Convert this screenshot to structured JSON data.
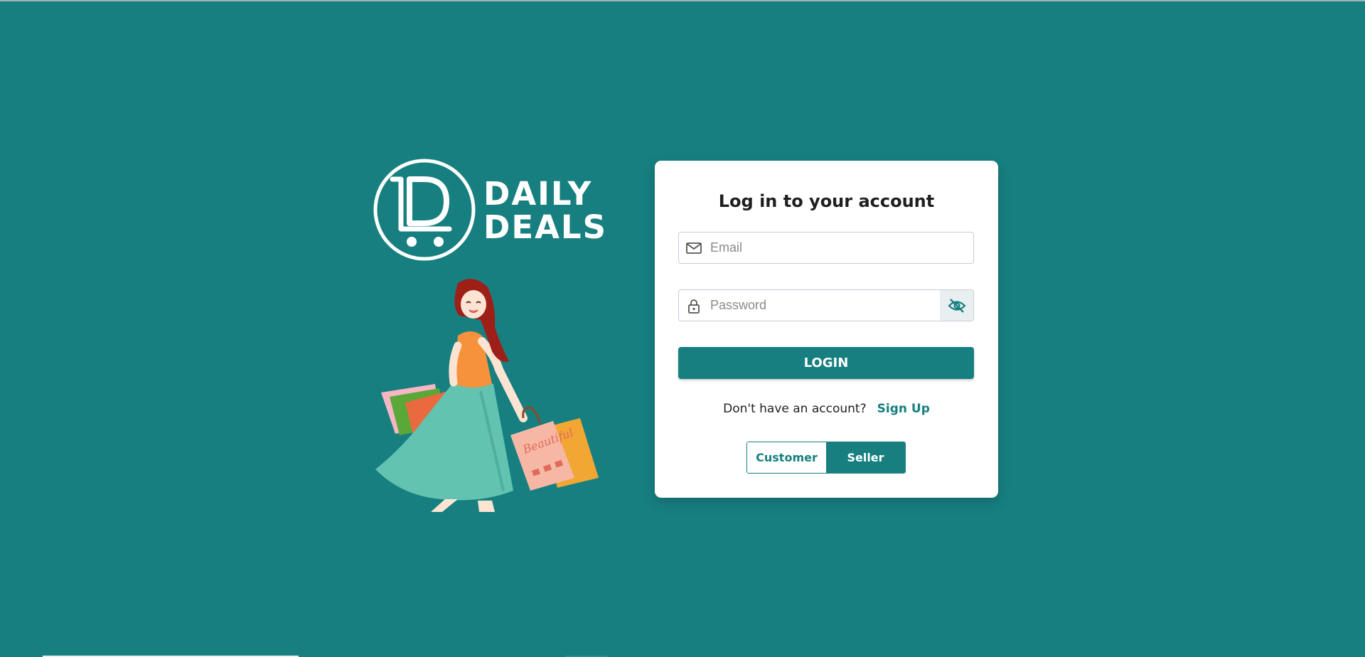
{
  "brand": {
    "line1": "DAILY",
    "line2": "DEALS",
    "logo_icon": "cart-d-logo-icon"
  },
  "illustration": {
    "icon": "shopping-woman-illustration",
    "bag_text": "Beautiful"
  },
  "login": {
    "title": "Log in to your account",
    "email_placeholder": "Email",
    "email_value": "",
    "password_placeholder": "Password",
    "password_value": "",
    "submit_label": "LOGIN",
    "signup_prompt": "Don't have an account?",
    "signup_link": "Sign Up"
  },
  "roles": {
    "options": [
      "Customer",
      "Seller"
    ],
    "selected": "Seller"
  },
  "colors": {
    "background": "#177f80",
    "accent": "#177f80",
    "card": "#ffffff"
  }
}
